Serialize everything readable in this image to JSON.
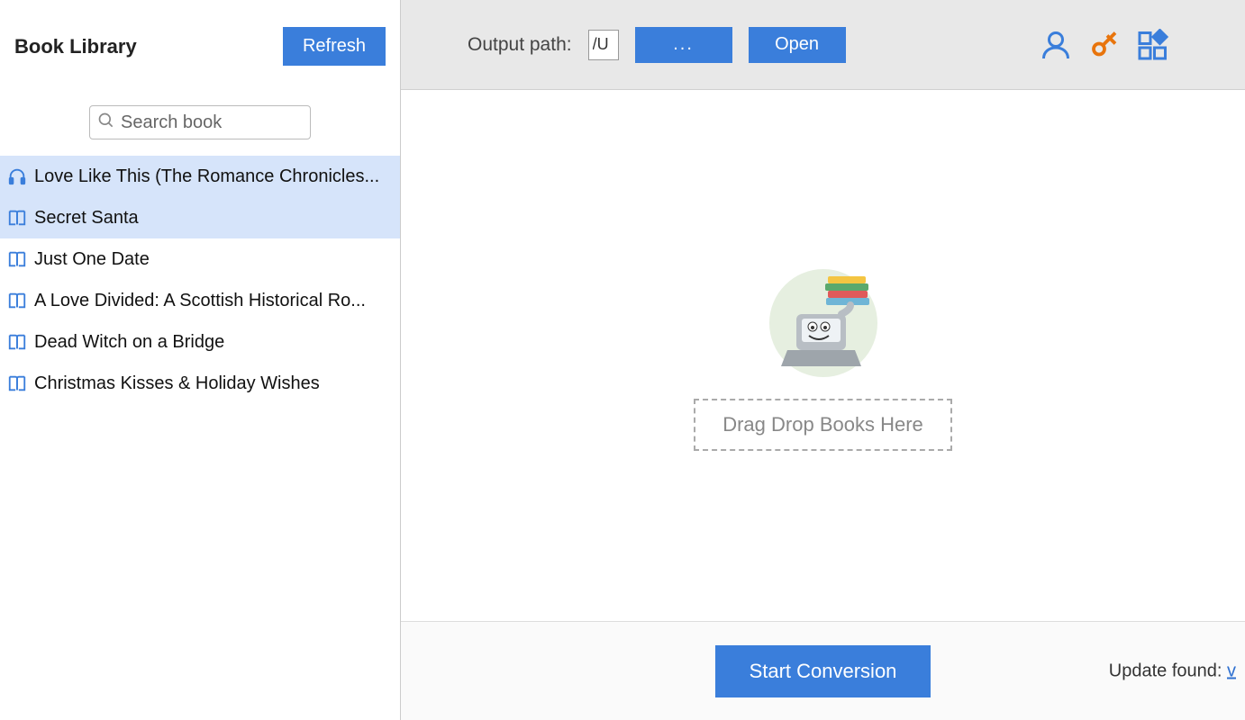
{
  "sidebar": {
    "title": "Book Library",
    "refresh_label": "Refresh",
    "search_placeholder": "Search book",
    "books": [
      {
        "title": "Love Like This (The Romance Chronicles...",
        "icon": "headphones",
        "selected": true
      },
      {
        "title": "Secret Santa",
        "icon": "book",
        "selected": true
      },
      {
        "title": "Just One Date",
        "icon": "book",
        "selected": false
      },
      {
        "title": "A Love Divided: A Scottish Historical Ro...",
        "icon": "book",
        "selected": false
      },
      {
        "title": "Dead Witch on a Bridge",
        "icon": "book",
        "selected": false
      },
      {
        "title": "Christmas Kisses & Holiday Wishes",
        "icon": "book",
        "selected": false
      }
    ]
  },
  "toolbar": {
    "output_label": "Output path:",
    "path_value": "/U",
    "browse_label": "...",
    "open_label": "Open"
  },
  "content": {
    "drop_text": "Drag Drop Books Here"
  },
  "footer": {
    "convert_label": "Start Conversion",
    "update_label": "Update found: ",
    "update_link": "v"
  }
}
